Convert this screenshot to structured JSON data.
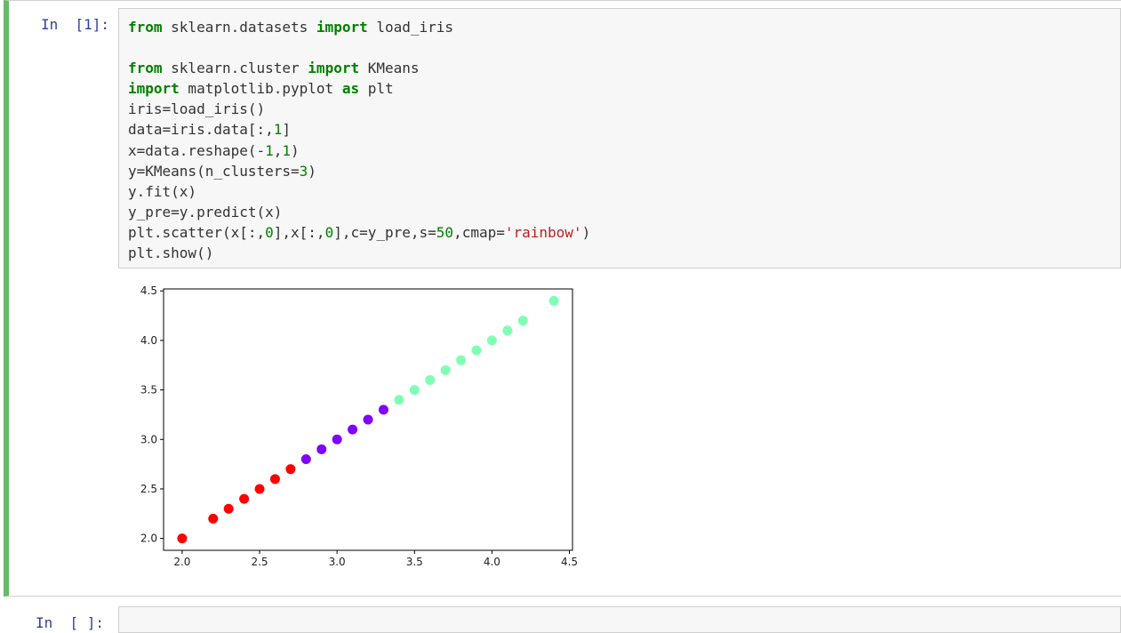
{
  "cell1": {
    "prompt": "In  [1]:",
    "code_lines": [
      [
        {
          "t": "from",
          "c": "kw"
        },
        {
          "t": " sklearn.datasets "
        },
        {
          "t": "import",
          "c": "kw"
        },
        {
          "t": " load_iris"
        }
      ],
      [],
      [
        {
          "t": "from",
          "c": "kw"
        },
        {
          "t": " sklearn.cluster "
        },
        {
          "t": "import",
          "c": "kw"
        },
        {
          "t": " KMeans"
        }
      ],
      [
        {
          "t": "import",
          "c": "kw"
        },
        {
          "t": " matplotlib.pyplot "
        },
        {
          "t": "as",
          "c": "kw"
        },
        {
          "t": " plt"
        }
      ],
      [
        {
          "t": "iris=load_iris()"
        }
      ],
      [
        {
          "t": "data=iris.data[:,"
        },
        {
          "t": "1",
          "c": "num"
        },
        {
          "t": "]"
        }
      ],
      [
        {
          "t": "x=data.reshape(-"
        },
        {
          "t": "1",
          "c": "num"
        },
        {
          "t": ","
        },
        {
          "t": "1",
          "c": "num"
        },
        {
          "t": ")"
        }
      ],
      [
        {
          "t": "y=KMeans(n_clusters="
        },
        {
          "t": "3",
          "c": "num"
        },
        {
          "t": ")"
        }
      ],
      [
        {
          "t": "y.fit(x)"
        }
      ],
      [
        {
          "t": "y_pre=y.predict(x)"
        }
      ],
      [
        {
          "t": "plt.scatter(x[:,"
        },
        {
          "t": "0",
          "c": "num"
        },
        {
          "t": "],x[:,"
        },
        {
          "t": "0",
          "c": "num"
        },
        {
          "t": "],c=y_pre,s="
        },
        {
          "t": "50",
          "c": "num"
        },
        {
          "t": ",cmap="
        },
        {
          "t": "'rainbow'",
          "c": "str"
        },
        {
          "t": ")"
        }
      ],
      [
        {
          "t": "plt.show()"
        }
      ]
    ]
  },
  "cell2": {
    "prompt": "In  [ ]:"
  },
  "colors": {
    "cluster_red": "#ff0000",
    "cluster_purple": "#8000ff",
    "cluster_green": "#80ffb4",
    "cell_border": "#66bb6a"
  },
  "chart_data": {
    "type": "scatter",
    "xlim": [
      1.88,
      4.52
    ],
    "ylim": [
      1.88,
      4.52
    ],
    "xticks": [
      "2.0",
      "2.5",
      "3.0",
      "3.5",
      "4.0",
      "4.5"
    ],
    "yticks": [
      "2.0",
      "2.5",
      "3.0",
      "3.5",
      "4.0",
      "4.5"
    ],
    "grid": false,
    "points": [
      {
        "x": 2.0,
        "y": 2.0,
        "cluster": "red"
      },
      {
        "x": 2.2,
        "y": 2.2,
        "cluster": "red"
      },
      {
        "x": 2.3,
        "y": 2.3,
        "cluster": "red"
      },
      {
        "x": 2.4,
        "y": 2.4,
        "cluster": "red"
      },
      {
        "x": 2.5,
        "y": 2.5,
        "cluster": "red"
      },
      {
        "x": 2.6,
        "y": 2.6,
        "cluster": "red"
      },
      {
        "x": 2.7,
        "y": 2.7,
        "cluster": "red"
      },
      {
        "x": 2.8,
        "y": 2.8,
        "cluster": "purple"
      },
      {
        "x": 2.9,
        "y": 2.9,
        "cluster": "purple"
      },
      {
        "x": 3.0,
        "y": 3.0,
        "cluster": "purple"
      },
      {
        "x": 3.1,
        "y": 3.1,
        "cluster": "purple"
      },
      {
        "x": 3.2,
        "y": 3.2,
        "cluster": "purple"
      },
      {
        "x": 3.3,
        "y": 3.3,
        "cluster": "purple"
      },
      {
        "x": 3.4,
        "y": 3.4,
        "cluster": "green"
      },
      {
        "x": 3.5,
        "y": 3.5,
        "cluster": "green"
      },
      {
        "x": 3.6,
        "y": 3.6,
        "cluster": "green"
      },
      {
        "x": 3.7,
        "y": 3.7,
        "cluster": "green"
      },
      {
        "x": 3.8,
        "y": 3.8,
        "cluster": "green"
      },
      {
        "x": 3.9,
        "y": 3.9,
        "cluster": "green"
      },
      {
        "x": 4.0,
        "y": 4.0,
        "cluster": "green"
      },
      {
        "x": 4.1,
        "y": 4.1,
        "cluster": "green"
      },
      {
        "x": 4.2,
        "y": 4.2,
        "cluster": "green"
      },
      {
        "x": 4.4,
        "y": 4.4,
        "cluster": "green"
      }
    ]
  }
}
